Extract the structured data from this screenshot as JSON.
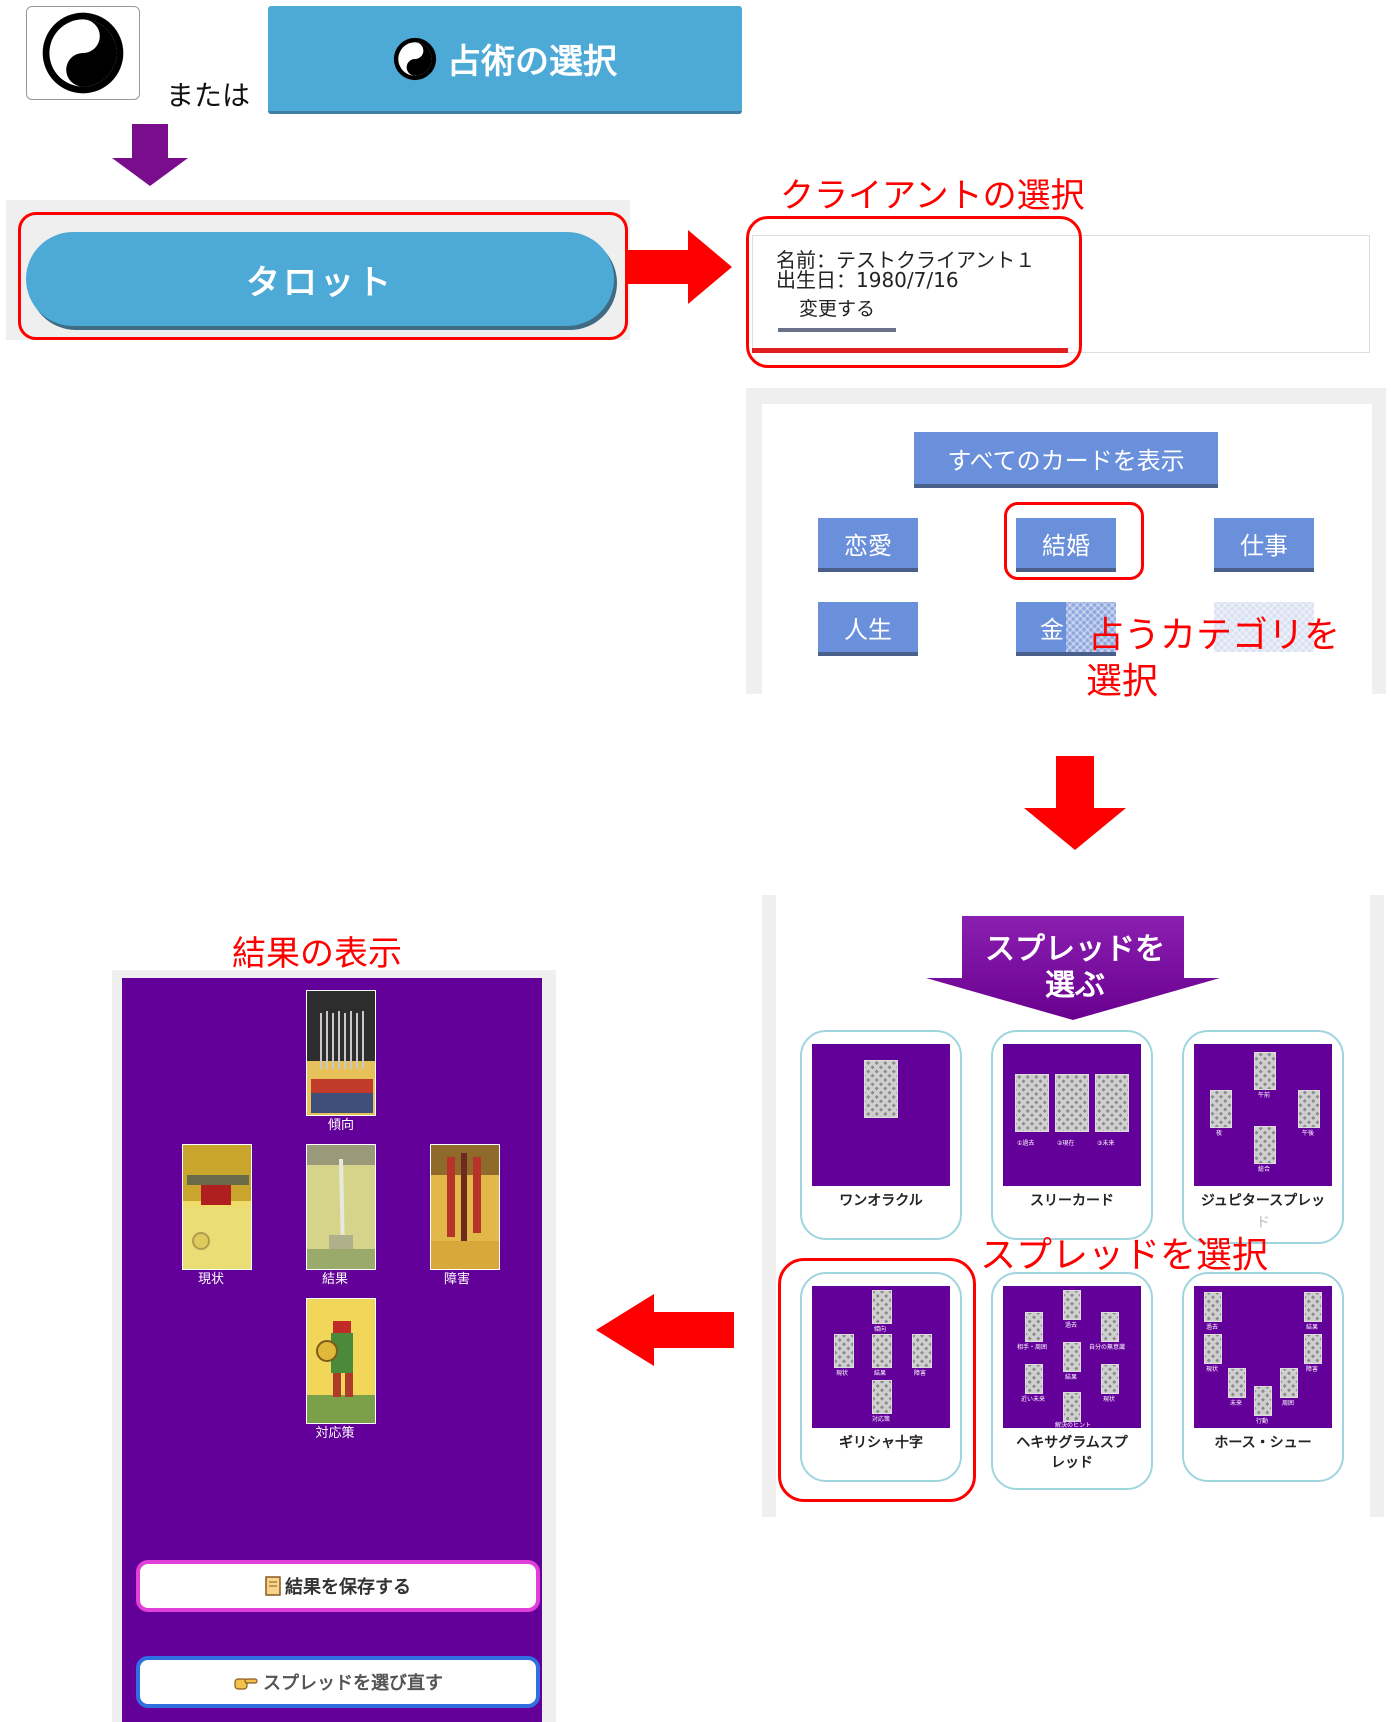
{
  "top": {
    "or_label": "または",
    "divine_button_label": "占術の選択"
  },
  "tarot_button_label": "タロット",
  "client_section": {
    "heading": "クライアントの選択",
    "name_line": "名前：テストクライアント１",
    "birth_line": "出生日：1980/7/16",
    "change_button": "変更する"
  },
  "categories": {
    "show_all": "すべてのカードを表示",
    "items": [
      "恋愛",
      "結婚",
      "仕事",
      "人生",
      "金"
    ],
    "annotation": [
      "占うカテゴリを",
      "選択"
    ]
  },
  "spread_section": {
    "banner": [
      "スプレッドを",
      "選ぶ"
    ],
    "annotation": "スプレッドを選択",
    "spreads": [
      {
        "name": "ワンオラクル",
        "extra": ""
      },
      {
        "name": "スリーカード",
        "extra": ""
      },
      {
        "name": "ジュピタースプレッ",
        "extra": "ド"
      },
      {
        "name": "ギリシャ十字",
        "extra": ""
      },
      {
        "name": "ヘキサグラムスプ",
        "extra": "レッド"
      },
      {
        "name": "ホース・シュー",
        "extra": ""
      }
    ],
    "three_card_labels": [
      "①過去",
      "②現在",
      "③未来"
    ],
    "jupiter_labels": [
      "午前",
      "夜",
      "午後",
      "総合"
    ],
    "greek_labels": [
      "傾向",
      "現状",
      "結果",
      "障害",
      "対応策"
    ],
    "hexagram_labels": [
      "過去",
      "相手・周囲",
      "自分の無意識",
      "結果",
      "近い未来",
      "解決のヒント",
      "現状"
    ],
    "horseshoe_labels": [
      "過去",
      "結果",
      "現状",
      "障害",
      "未来",
      "周囲",
      "行動"
    ]
  },
  "result_section": {
    "heading": "結果の表示",
    "positions": [
      "傾向",
      "現状",
      "結果",
      "障害",
      "対応策"
    ],
    "save_button": "結果を保存する",
    "reselect_button": "スプレッドを選び直す"
  },
  "colors": {
    "accent_blue": "#4da9d6",
    "category_blue": "#6a8fdb",
    "highlight_red": "#ff0000",
    "purple": "#64009a",
    "arrow_purple": "#7a0d8c"
  },
  "icons": [
    "yin-yang-icon",
    "save-icon",
    "pointing-hand-icon"
  ]
}
